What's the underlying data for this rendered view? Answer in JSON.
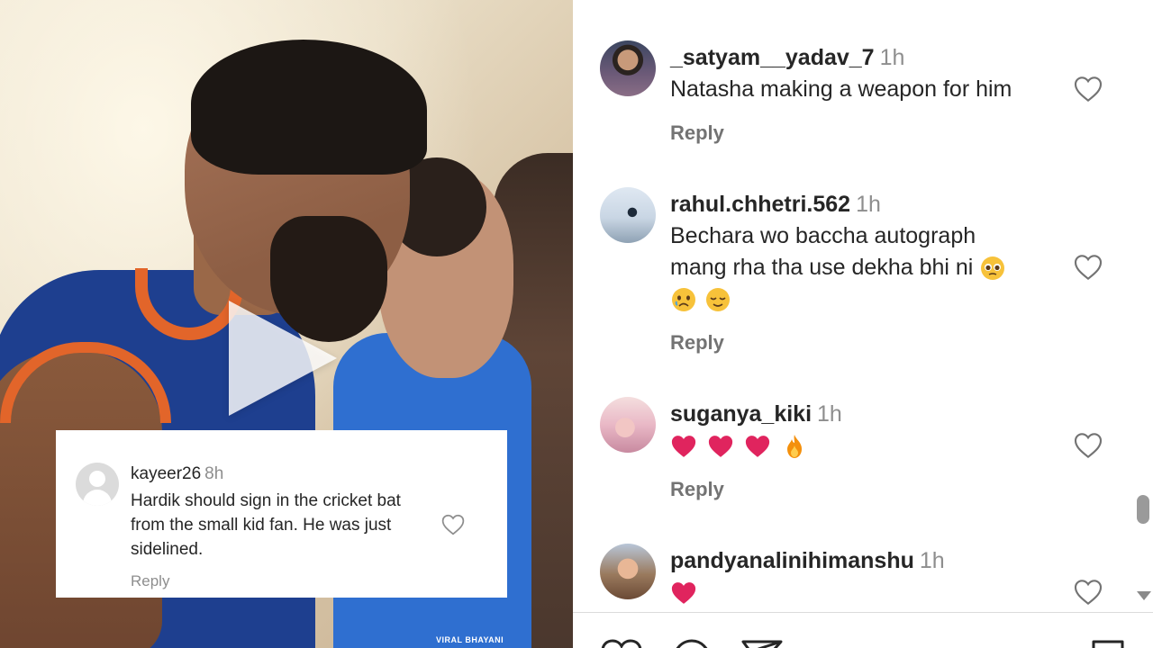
{
  "video": {
    "watermark": "VIRAL BHAYANI"
  },
  "overlay_comment": {
    "username": "kayeer26",
    "time": "8h",
    "text": "Hardik should sign in the cricket bat from the small kid fan. He was just sidelined.",
    "reply_label": "Reply"
  },
  "comments": [
    {
      "username": "_satyam__yadav_7",
      "time": "1h",
      "text": "Natasha making a weapon for him",
      "reply_label": "Reply"
    },
    {
      "username": "rahul.chhetri.562",
      "time": "1h",
      "text_line1": "Bechara wo baccha autograph",
      "text_line2": "mang rha tha use dekha bhi ni",
      "emojis": [
        "pleading-face",
        "sad-face",
        "relieved-face"
      ],
      "reply_label": "Reply"
    },
    {
      "username": "suganya_kiki",
      "time": "1h",
      "emojis": [
        "red-heart",
        "red-heart",
        "red-heart",
        "fire"
      ],
      "reply_label": "Reply"
    },
    {
      "username": "pandyanalinihimanshu",
      "time": "1h",
      "emojis": [
        "red-heart"
      ]
    }
  ],
  "colors": {
    "text": "#262626",
    "muted": "#8e8e8e",
    "heart_emoji": "#e0245e",
    "jersey_blue": "#1e3f8f",
    "jersey_orange": "#e2652a"
  }
}
